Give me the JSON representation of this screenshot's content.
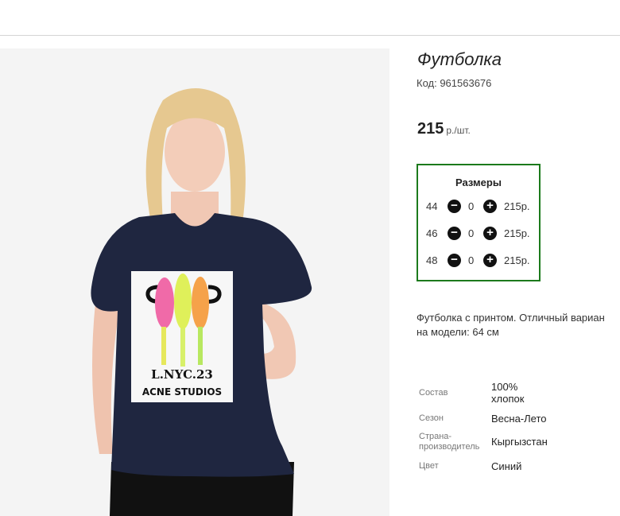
{
  "product": {
    "title": "Футболка",
    "code": "Код: 961563676",
    "price": "215",
    "price_unit": "р./шт."
  },
  "sizes": {
    "header": "Размеры",
    "rows": [
      {
        "size": "44",
        "qty": "0",
        "price": "215р."
      },
      {
        "size": "46",
        "qty": "0",
        "price": "215р."
      },
      {
        "size": "48",
        "qty": "0",
        "price": "215р."
      }
    ],
    "minus_glyph": "−",
    "plus_glyph": "+"
  },
  "description": {
    "line1": "Футболка с принтом. Отличный вариан",
    "line2": "на модели: 64 см"
  },
  "properties": [
    {
      "key": "Состав",
      "value": "100% хлопок"
    },
    {
      "key": "Сезон",
      "value": "Весна-Лето"
    },
    {
      "key": "Страна-производитель",
      "value": "Кыргызстан"
    },
    {
      "key": "Цвет",
      "value": "Синий"
    }
  ],
  "photo": {
    "print_text1": "L.NYC.23",
    "print_text2": "ACNE STUDIOS",
    "shirt_color": "#1f2640"
  },
  "colors": {
    "sizes_border": "#1c7a1c"
  },
  "icons": {
    "minus": "minus-circle-icon",
    "plus": "plus-circle-icon"
  }
}
